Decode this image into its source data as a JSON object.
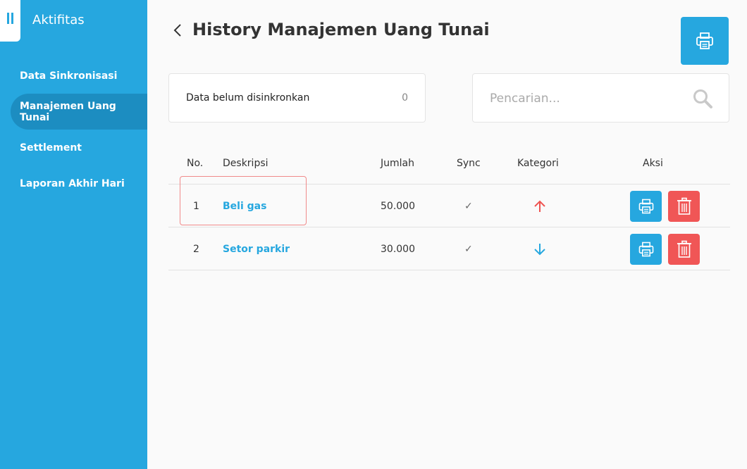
{
  "sidebar": {
    "title": "Aktifitas",
    "items": [
      {
        "label": "Data Sinkronisasi",
        "active": false
      },
      {
        "label": "Manajemen Uang Tunai",
        "active": true
      },
      {
        "label": "Settlement",
        "active": false
      },
      {
        "label": "Laporan Akhir Hari",
        "active": false
      }
    ]
  },
  "header": {
    "title": "History Manajemen Uang Tunai"
  },
  "unsync": {
    "label": "Data belum disinkronkan",
    "count": "0"
  },
  "search": {
    "placeholder": "Pencarian..."
  },
  "table": {
    "columns": {
      "no": "No.",
      "desc": "Deskripsi",
      "amount": "Jumlah",
      "sync": "Sync",
      "category": "Kategori",
      "actions": "Aksi"
    },
    "rows": [
      {
        "no": "1",
        "desc": "Beli gas",
        "amount": "50.000",
        "sync": "✓",
        "category": "up"
      },
      {
        "no": "2",
        "desc": "Setor parkir",
        "amount": "30.000",
        "sync": "✓",
        "category": "down"
      }
    ]
  },
  "colors": {
    "primary": "#26a7df",
    "active_nav": "#1c8dc1",
    "danger": "#f05656",
    "arrow_up": "#ef5350",
    "arrow_down": "#26a7df"
  },
  "icons": {
    "menu": "menu-icon",
    "back": "chevron-left-icon",
    "print": "printer-icon",
    "search": "search-icon",
    "delete": "trash-icon",
    "up": "arrow-up-icon",
    "down": "arrow-down-icon"
  }
}
